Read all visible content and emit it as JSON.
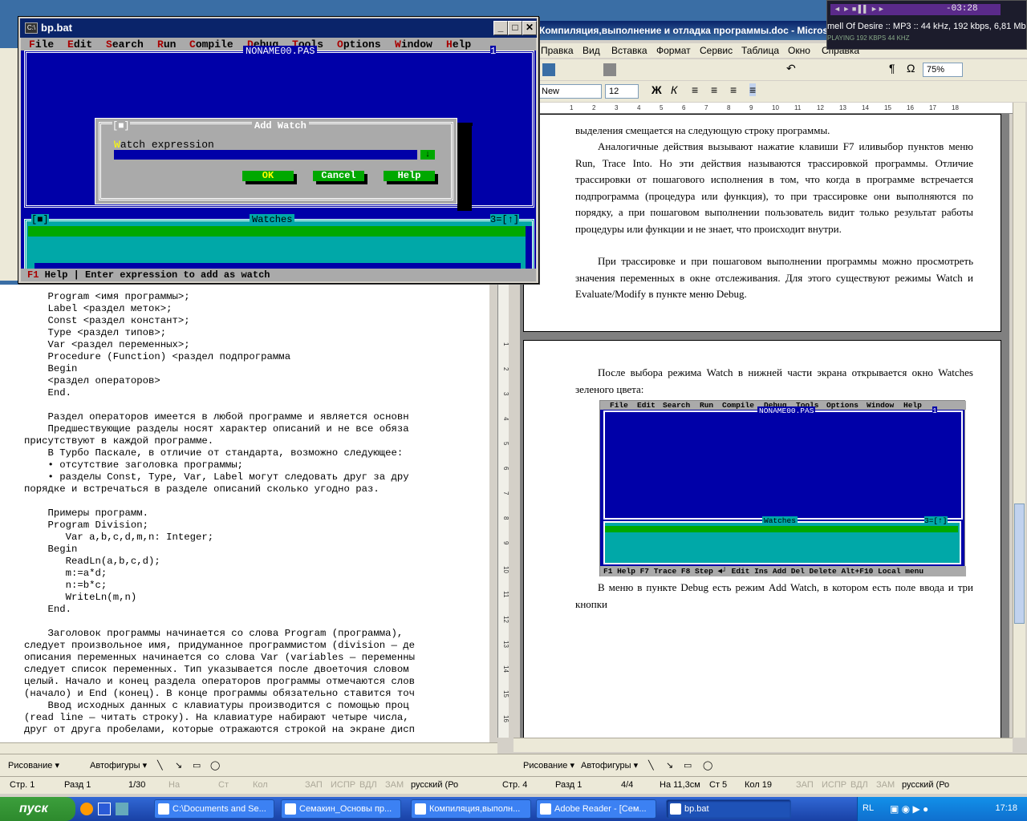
{
  "bp_window": {
    "title": "bp.bat",
    "min": "_",
    "max": "□",
    "close": "✕",
    "menu": [
      "File",
      "Edit",
      "Search",
      "Run",
      "Compile",
      "Debug",
      "Tools",
      "Options",
      "Window",
      "Help"
    ],
    "menu_hot": [
      "F",
      "E",
      "S",
      "R",
      "C",
      "D",
      "T",
      "O",
      "W",
      "H"
    ],
    "editor_title": "NONAME00.PAS",
    "editor_num": "1",
    "dialog": {
      "title": "Add Watch",
      "close_glyph": "[■]",
      "field_label": "Watch expression",
      "field_hot": "W",
      "field_value": "",
      "dropdown": "↓",
      "ok": "OK",
      "cancel": "Cancel",
      "help": "Help"
    },
    "watches_title": "Watches",
    "watches_num": "3=[↑]",
    "watches_close": "[■]",
    "status_key": "F1",
    "status_help": "Help",
    "status_sep": "|",
    "status_text": "Enter expression to add as watch"
  },
  "left_doc": {
    "lines": [
      {
        "t": "    Program <имя программы>;"
      },
      {
        "t": "    Label <раздел меток>;"
      },
      {
        "t": "    Const <раздел констант>;"
      },
      {
        "t": "    Type <раздел типов>;"
      },
      {
        "t": "    Var <раздел переменных>;"
      },
      {
        "t": "    Procedure (Function) <раздел подпрограмма"
      },
      {
        "t": "    Begin"
      },
      {
        "t": "    <раздел операторов>"
      },
      {
        "t": "    End."
      },
      {
        "t": ""
      },
      {
        "t": "    Раздел операторов имеется в любой программе и является основн"
      },
      {
        "t": "    Предшествующие разделы носят характер описаний и не все обяза"
      },
      {
        "t": "присутствуют в каждой программе."
      },
      {
        "t": "    В Турбо Паскале, в отличие от стандарта, возможно следующее:"
      },
      {
        "t": "    • отсутствие заголовка программы;"
      },
      {
        "t": "    • разделы Const, Type, Var, Label могут следовать друг за дру"
      },
      {
        "t": "порядке и встречаться в разделе описаний сколько угодно раз."
      },
      {
        "t": ""
      },
      {
        "t": "    Примеры программ."
      },
      {
        "t": "    Program Division;"
      },
      {
        "t": "       Var a,b,c,d,m,n: Integer;"
      },
      {
        "t": "    Begin"
      },
      {
        "t": "       ReadLn(a,b,c,d);"
      },
      {
        "t": "       m:=a*d;"
      },
      {
        "t": "       n:=b*c;"
      },
      {
        "t": "       WriteLn(m,n)"
      },
      {
        "t": "    End."
      },
      {
        "t": ""
      },
      {
        "t": "    Заголовок программы начинается со слова Program (программа),"
      },
      {
        "t": "следует произвольное имя, придуманное программистом (division — де"
      },
      {
        "t": "описания переменных начинается со слова Var (variables — переменны"
      },
      {
        "t": "следует список переменных. Тип указывается после двоеточия словом"
      },
      {
        "t": "целый. Начало и конец раздела операторов программы отмечаются слов"
      },
      {
        "t": "(начало) и End (конец). В конце программы обязательно ставится точ"
      },
      {
        "t": "    Ввод исходных данных с клавиатуры производится с помощью проц"
      },
      {
        "t": "(read line — читать строку). На клавиатуре набирают четыре числа,"
      },
      {
        "t": "друг от друга пробелами, которые отражаются строкой на экране дисп"
      }
    ],
    "ruler": [
      "1",
      "2",
      "3",
      "4",
      "5",
      "6",
      "7",
      "8",
      "9",
      "10",
      "11",
      "12",
      "13",
      "14",
      "15",
      "16"
    ]
  },
  "right_word": {
    "title": "Компиляция,выполнение и отладка программы.doc - Microsoft Word",
    "menu": [
      "Правка",
      "Вид",
      "Вставка",
      "Формат",
      "Сервис",
      "Таблица",
      "Окно",
      "Справка"
    ],
    "zoom": "75%",
    "font": "New",
    "size": "12",
    "ruler": [
      "1",
      "2",
      "3",
      "4",
      "5",
      "6",
      "7",
      "8",
      "9",
      "10",
      "11",
      "12",
      "13",
      "14",
      "15",
      "16",
      "17",
      "18"
    ],
    "page1": [
      "выделения смещается на следующую строку программы.",
      "Аналогичные действия вызывают нажатие клавиши F7 иливыбор пунктов меню Run, Trace Into. Но эти действия называются трассировкой программы. Отличие трассировки от пошагового исполнения в том, что когда в программе встречается подпрограмма (процедура или функция), то при трассировке они выполняются по порядку, а при пошаговом выполнении пользователь видит только результат работы процедуры или функции и не знает, что происходит внутри.",
      "При трассировке и при пошаговом выполнении программы можно просмотреть значения переменных в окне отслеживания. Для этого существуют режимы Watch и Evaluate/Modify в пункте меню Debug."
    ],
    "page2_a": "После выбора режима Watch в нижней части экрана открывается окно Watches зеленого цвета:",
    "page2_b": "В меню в пункте Debug есть режим Add Watch, в котором есть поле ввода и три кнопки",
    "mini": {
      "menu": [
        "File",
        "Edit",
        "Search",
        "Run",
        "Compile",
        "Debug",
        "Tools",
        "Options",
        "Window",
        "Help"
      ],
      "editor_title": "NONAME00.PAS",
      "editor_num": "1",
      "watches_title": "Watches",
      "watches_num": "3=[↑]",
      "status": "F1 Help  F7 Trace  F8 Step  ◄┘ Edit  Ins Add  Del Delete  Alt+F10 Local menu"
    }
  },
  "drawbar_left": {
    "draw": "Рисование ▾",
    "autoshapes": "Автофигуры ▾"
  },
  "drawbar_right": {
    "draw": "Рисование ▾",
    "autoshapes": "Автофигуры ▾"
  },
  "status_left": {
    "page": "Стр. 1",
    "section": "Разд  1",
    "pages": "1/30",
    "at": "На",
    "ln": "Ст",
    "col": "Кол",
    "rec": "ЗАП",
    "trk": "ИСПР",
    "ext": "ВДЛ",
    "ovr": "ЗАМ",
    "lang": "русский (Ро"
  },
  "status_right": {
    "page": "Стр. 4",
    "section": "Разд  1",
    "pages": "4/4",
    "at": "На 11,3см",
    "ln": "Ст 5",
    "col": "Кол 19",
    "rec": "ЗАП",
    "trk": "ИСПР",
    "ext": "ВДЛ",
    "ovr": "ЗАМ",
    "lang": "русский (Ро"
  },
  "taskbar": {
    "start": "пуск",
    "items": [
      "C:\\Documents and Se...",
      "Семакин_Основы пр...",
      "Компиляция,выполн...",
      "Adobe Reader - [Сем...",
      "bp.bat"
    ],
    "lang": "RL",
    "clock": "17:18"
  },
  "winamp": {
    "time": "-03:28",
    "info": "mell Of Desire :: MP3 :: 44 kHz, 192 kbps, 6,81 Mb ::",
    "small": "PLAYING    192 KBPS   44 KHZ"
  },
  "colors": {
    "dos_blue": "#0000a8",
    "dos_cyan": "#00a8a8",
    "dos_green": "#00a800",
    "dos_grey": "#aaaaaa"
  }
}
